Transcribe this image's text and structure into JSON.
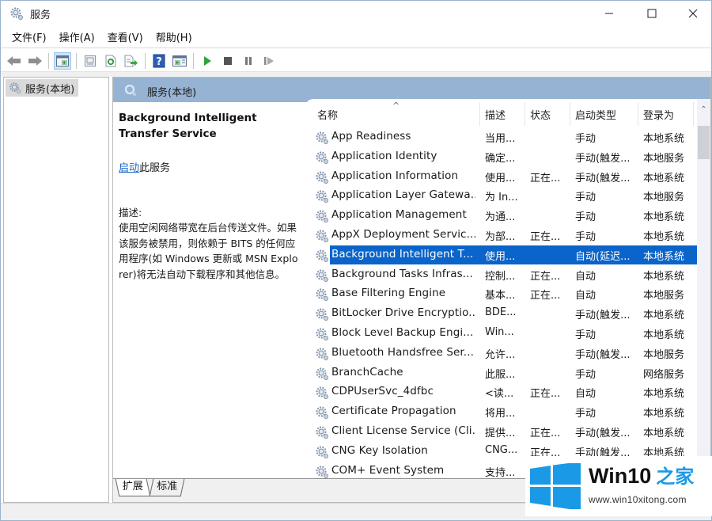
{
  "window": {
    "title": "服务",
    "controls": {
      "minimize": "minimize",
      "maximize": "maximize",
      "close": "close"
    }
  },
  "menu": [
    {
      "label": "文件(F)"
    },
    {
      "label": "操作(A)"
    },
    {
      "label": "查看(V)"
    },
    {
      "label": "帮助(H)"
    }
  ],
  "toolbar": [
    {
      "icon": "back-arrow-icon"
    },
    {
      "icon": "forward-arrow-icon"
    },
    {
      "icon": "show-hide-console-tree-icon",
      "active": true
    },
    {
      "icon": "properties-icon"
    },
    {
      "icon": "refresh-icon"
    },
    {
      "icon": "export-list-icon"
    },
    {
      "icon": "help-icon"
    },
    {
      "icon": "show-action-pane-icon"
    },
    {
      "icon": "start-service-icon"
    },
    {
      "icon": "stop-service-icon"
    },
    {
      "icon": "pause-service-icon"
    },
    {
      "icon": "resume-service-icon"
    }
  ],
  "tree": {
    "items": [
      {
        "label": "服务(本地)",
        "selected": true
      }
    ]
  },
  "panel": {
    "header": "服务(本地)",
    "detail": {
      "service_name": "Background Intelligent Transfer Service",
      "action_link": "启动",
      "action_suffix": "此服务",
      "description_label": "描述:",
      "description": "使用空闲网络带宽在后台传送文件。如果该服务被禁用，则依赖于 BITS 的任何应用程序(如 Windows 更新或 MSN Explorer)将无法自动下载程序和其他信息。"
    },
    "columns": {
      "name": "名称",
      "description": "描述",
      "status": "状态",
      "startup_type": "启动类型",
      "log_on_as": "登录为"
    },
    "sort": {
      "column": "name",
      "direction": "ascending"
    },
    "rows": [
      {
        "name": "App Readiness",
        "description": "当用...",
        "status": "",
        "startup": "手动",
        "logon": "本地系统"
      },
      {
        "name": "Application Identity",
        "description": "确定...",
        "status": "",
        "startup": "手动(触发...",
        "logon": "本地服务"
      },
      {
        "name": "Application Information",
        "description": "使用...",
        "status": "正在...",
        "startup": "手动(触发...",
        "logon": "本地系统"
      },
      {
        "name": "Application Layer Gatewa...",
        "description": "为 In...",
        "status": "",
        "startup": "手动",
        "logon": "本地服务"
      },
      {
        "name": "Application Management",
        "description": "为通...",
        "status": "",
        "startup": "手动",
        "logon": "本地系统"
      },
      {
        "name": "AppX Deployment Servic...",
        "description": "为部...",
        "status": "正在...",
        "startup": "手动",
        "logon": "本地系统"
      },
      {
        "name": "Background Intelligent T...",
        "description": "使用...",
        "status": "",
        "startup": "自动(延迟...",
        "logon": "本地系统",
        "selected": true
      },
      {
        "name": "Background Tasks Infras...",
        "description": "控制...",
        "status": "正在...",
        "startup": "自动",
        "logon": "本地系统"
      },
      {
        "name": "Base Filtering Engine",
        "description": "基本...",
        "status": "正在...",
        "startup": "自动",
        "logon": "本地服务"
      },
      {
        "name": "BitLocker Drive Encryptio...",
        "description": "BDE...",
        "status": "",
        "startup": "手动(触发...",
        "logon": "本地系统"
      },
      {
        "name": "Block Level Backup Engi...",
        "description": "Win...",
        "status": "",
        "startup": "手动",
        "logon": "本地系统"
      },
      {
        "name": "Bluetooth Handsfree Ser...",
        "description": "允许...",
        "status": "",
        "startup": "手动(触发...",
        "logon": "本地服务"
      },
      {
        "name": "BranchCache",
        "description": "此服...",
        "status": "",
        "startup": "手动",
        "logon": "网络服务"
      },
      {
        "name": "CDPUserSvc_4dfbc",
        "description": "<读...",
        "status": "正在...",
        "startup": "自动",
        "logon": "本地系统"
      },
      {
        "name": "Certificate Propagation",
        "description": "将用...",
        "status": "",
        "startup": "手动",
        "logon": "本地系统"
      },
      {
        "name": "Client License Service (Cli...",
        "description": "提供...",
        "status": "正在...",
        "startup": "手动(触发...",
        "logon": "本地系统"
      },
      {
        "name": "CNG Key Isolation",
        "description": "CNG...",
        "status": "正在...",
        "startup": "手动(触发...",
        "logon": "本地系统"
      },
      {
        "name": "COM+ Event System",
        "description": "支持...",
        "status": "",
        "startup": "",
        "logon": ""
      }
    ],
    "tabs": [
      {
        "label": "扩展",
        "active": true
      },
      {
        "label": "标准",
        "active": false
      }
    ]
  },
  "watermark": {
    "title": "Win10",
    "title_cn": "之家",
    "url": "www.win10xitong.com"
  },
  "colors": {
    "panel_header": "#97b3d4",
    "selection": "#0a64c9",
    "link": "#1b65c6",
    "watermark_blue": "#1a9ae6"
  }
}
